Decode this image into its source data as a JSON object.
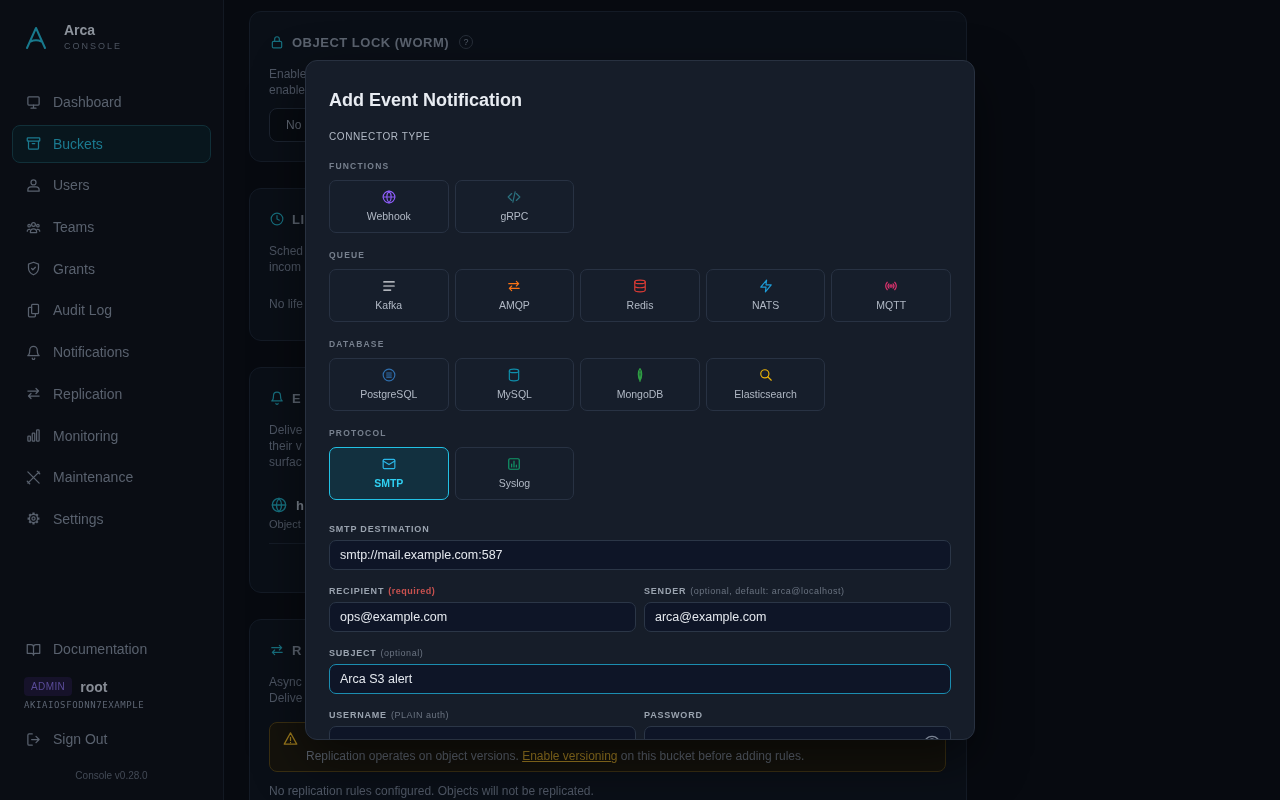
{
  "sidebar": {
    "brand": {
      "name": "Arca",
      "subtitle": "CONSOLE"
    },
    "nav": [
      {
        "label": "Dashboard",
        "selected": false
      },
      {
        "label": "Buckets",
        "selected": true
      },
      {
        "label": "Users",
        "selected": false
      },
      {
        "label": "Teams",
        "selected": false
      },
      {
        "label": "Grants",
        "selected": false
      },
      {
        "label": "Audit Log",
        "selected": false
      },
      {
        "label": "Notifications",
        "selected": false
      },
      {
        "label": "Replication",
        "selected": false
      },
      {
        "label": "Monitoring",
        "selected": false
      },
      {
        "label": "Maintenance",
        "selected": false
      },
      {
        "label": "Settings",
        "selected": false
      }
    ],
    "docs_link": "Documentation",
    "user": {
      "role": "ADMIN",
      "name": "root",
      "access_key": "AKIAIOSFODNN7EXAMPLE"
    },
    "sign_out": "Sign Out",
    "version": "Console v0.28.0"
  },
  "sections": [
    {
      "title": "OBJECT LOCK (WORM)",
      "help": "?",
      "description": [
        "Enable",
        "enable"
      ],
      "select_value": "No"
    },
    {
      "title": "LI",
      "description": [
        "Sched",
        "incom"
      ],
      "empty_text": "No life"
    },
    {
      "title": "E",
      "description": [
        "Delive",
        "their v",
        "surfac"
      ],
      "target": {
        "url": "h",
        "events": "Object"
      }
    },
    {
      "title": "R",
      "description": [
        "Async",
        "Delive"
      ],
      "warning": {
        "before": "Replication operates on object versions.",
        "link": "Enable versioning",
        "after": "on this bucket before adding rules."
      },
      "empty_text": "No replication rules configured. Objects will not be replicated."
    }
  ],
  "modal": {
    "title": "Add Event Notification",
    "section_label": "CONNECTOR TYPE",
    "groups": [
      {
        "label": "FUNCTIONS",
        "connectors": [
          {
            "name": "Webhook",
            "selected": false
          },
          {
            "name": "gRPC",
            "selected": false
          }
        ]
      },
      {
        "label": "QUEUE",
        "connectors": [
          {
            "name": "Kafka",
            "selected": false
          },
          {
            "name": "AMQP",
            "selected": false
          },
          {
            "name": "Redis",
            "selected": false
          },
          {
            "name": "NATS",
            "selected": false
          },
          {
            "name": "MQTT",
            "selected": false
          }
        ]
      },
      {
        "label": "DATABASE",
        "connectors": [
          {
            "name": "PostgreSQL",
            "selected": false
          },
          {
            "name": "MySQL",
            "selected": false
          },
          {
            "name": "MongoDB",
            "selected": false
          },
          {
            "name": "Elasticsearch",
            "selected": false
          }
        ]
      },
      {
        "label": "PROTOCOL",
        "connectors": [
          {
            "name": "SMTP",
            "selected": true
          },
          {
            "name": "Syslog",
            "selected": false
          }
        ]
      }
    ],
    "field_rows": [
      [
        {
          "label": "SMTP DESTINATION",
          "kind": "text",
          "value": "smtp://mail.example.com:587",
          "focused": false
        }
      ],
      [
        {
          "label": "RECIPIENT",
          "note": {
            "text": "(required)",
            "required": true
          },
          "kind": "text",
          "value": "ops@example.com",
          "focused": false
        },
        {
          "label": "SENDER",
          "note": {
            "text": "(optional, default: arca@localhost)",
            "required": false
          },
          "kind": "text",
          "value": "arca@example.com",
          "focused": false
        }
      ],
      [
        {
          "label": "SUBJECT",
          "note": {
            "text": "(optional)",
            "required": false
          },
          "kind": "text",
          "value": "Arca S3 alert",
          "focused": true
        }
      ],
      [
        {
          "label": "USERNAME",
          "note": {
            "text": "(PLAIN auth)",
            "required": false
          },
          "kind": "text",
          "focused": false
        },
        {
          "label": "PASSWORD",
          "kind": "password",
          "focused": false
        }
      ]
    ]
  }
}
